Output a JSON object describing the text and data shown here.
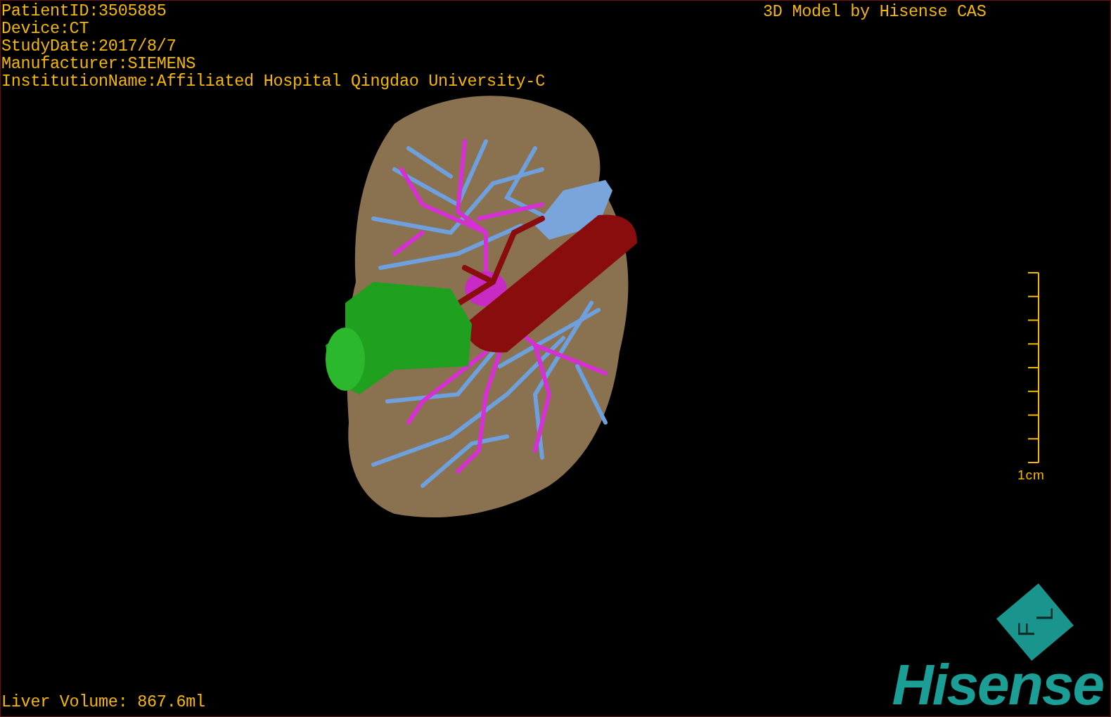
{
  "info_lines": [
    "PatientID:3505885",
    "Device:CT",
    "StudyDate:2017/8/7",
    "Manufacturer:SIEMENS",
    "InstitutionName:Affiliated Hospital Qingdao University-C"
  ],
  "model_credit": "3D Model by Hisense CAS",
  "scale_bar": {
    "label": "1cm"
  },
  "liver_volume": "Liver Volume: 867.6ml",
  "orientation_cube": {
    "labels": [
      "F",
      "L"
    ]
  },
  "logo": {
    "text": "Hisense"
  }
}
